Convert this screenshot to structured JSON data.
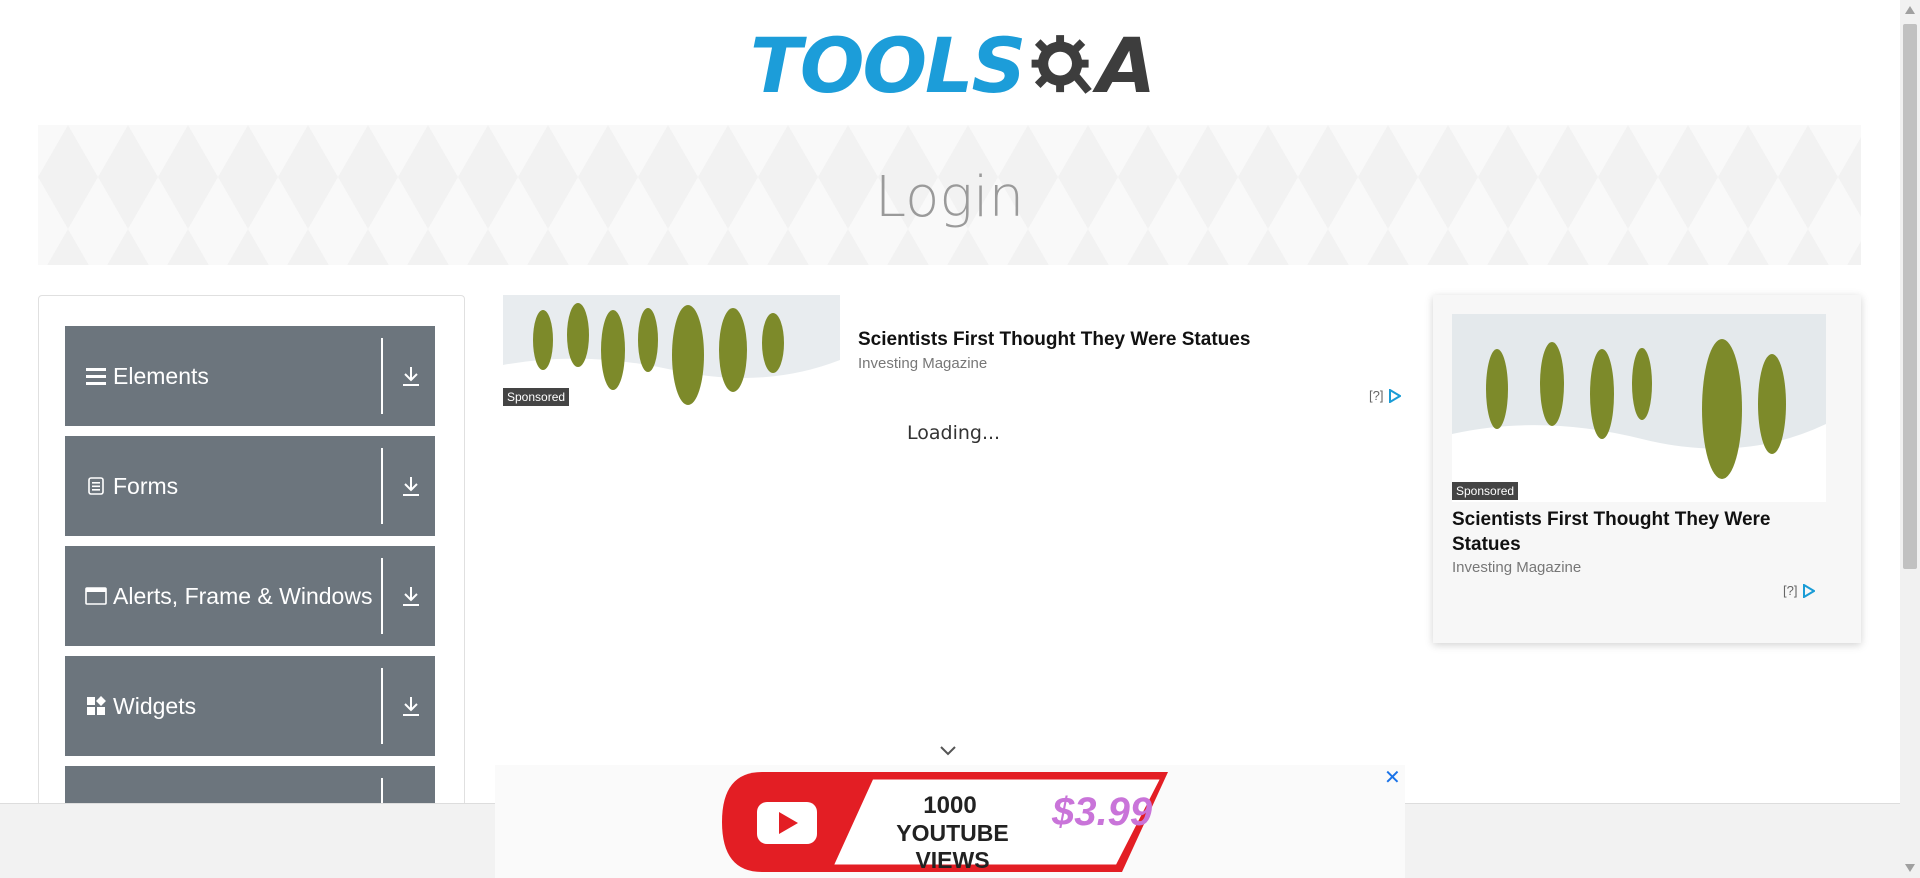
{
  "logo": {
    "text_left": "TOOLS",
    "text_right": "A",
    "colors": {
      "blue": "#1c9dd9",
      "dark": "#3d3d3d"
    }
  },
  "banner": {
    "title": "Login"
  },
  "sidebar": {
    "groups": [
      {
        "label": "Elements",
        "icon": "hamburger-icon"
      },
      {
        "label": "Forms",
        "icon": "document-icon"
      },
      {
        "label": "Alerts, Frame & Windows",
        "icon": "window-icon"
      },
      {
        "label": "Widgets",
        "icon": "widgets-icon"
      },
      {
        "label": "",
        "icon": ""
      }
    ],
    "group_color": "#6c757d"
  },
  "ad_inline": {
    "sponsored": "Sponsored",
    "title": "Scientists First Thought They Were Statues",
    "source": "Investing Magazine",
    "adchoice": "[?]"
  },
  "loading": "Loading...",
  "ad_side": {
    "sponsored": "Sponsored",
    "title": "Scientists First Thought They Were Statues",
    "source": "Investing Magazine",
    "adchoice": "[?]"
  },
  "bottom_ad": {
    "line1": "1000",
    "line2": "YOUTUBE VIEWS",
    "price": "$3.99",
    "close": "✕"
  }
}
